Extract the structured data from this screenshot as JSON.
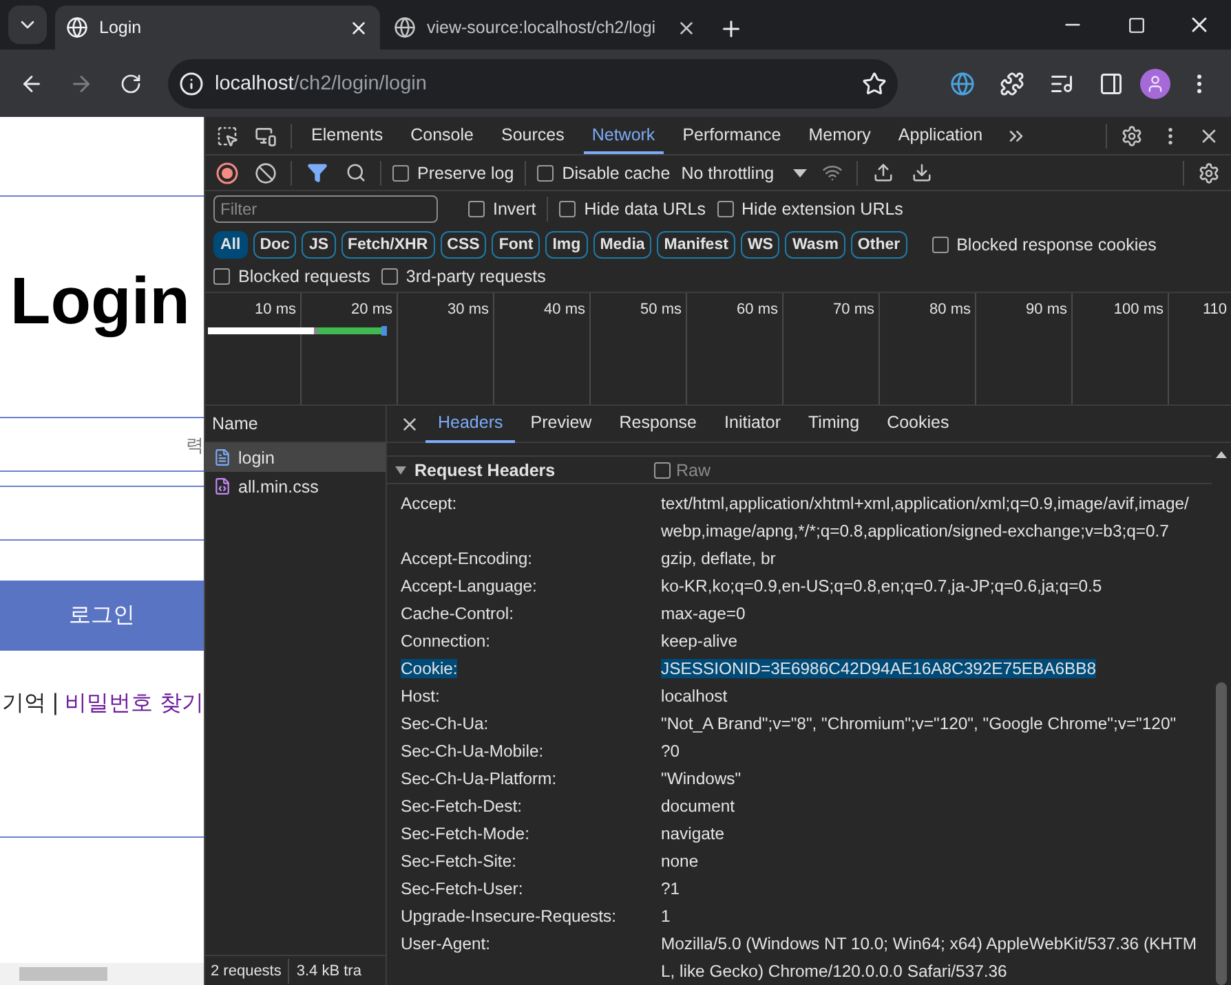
{
  "browser": {
    "tabs": [
      {
        "title": "Login",
        "selected": true
      },
      {
        "title": "view-source:localhost/ch2/logi",
        "selected": false
      }
    ],
    "address": {
      "host": "localhost",
      "path": "/ch2/login/login"
    }
  },
  "page": {
    "heading": "Login",
    "input_placeholder": "력",
    "button": "로그인",
    "remember": "기억",
    "separator": "|",
    "find_password": "비밀번호 찾기"
  },
  "devtools": {
    "panels": [
      {
        "label": "Elements",
        "selected": false
      },
      {
        "label": "Console",
        "selected": false
      },
      {
        "label": "Sources",
        "selected": false
      },
      {
        "label": "Network",
        "selected": true
      },
      {
        "label": "Performance",
        "selected": false
      },
      {
        "label": "Memory",
        "selected": false
      },
      {
        "label": "Application",
        "selected": false
      }
    ],
    "toolbar_options": [
      {
        "label": "Preserve log",
        "checked": false
      },
      {
        "label": "Disable cache",
        "checked": false
      }
    ],
    "throttling": "No throttling",
    "filter": {
      "placeholder": "Filter"
    },
    "filter_options": [
      {
        "label": "Invert",
        "checked": false
      },
      {
        "label": "Hide data URLs",
        "checked": false
      },
      {
        "label": "Hide extension URLs",
        "checked": false
      }
    ],
    "types": [
      {
        "label": "All",
        "selected": true
      },
      {
        "label": "Doc",
        "selected": false
      },
      {
        "label": "JS",
        "selected": false
      },
      {
        "label": "Fetch/XHR",
        "selected": false
      },
      {
        "label": "CSS",
        "selected": false
      },
      {
        "label": "Font",
        "selected": false
      },
      {
        "label": "Img",
        "selected": false
      },
      {
        "label": "Media",
        "selected": false
      },
      {
        "label": "Manifest",
        "selected": false
      },
      {
        "label": "WS",
        "selected": false
      },
      {
        "label": "Wasm",
        "selected": false
      },
      {
        "label": "Other",
        "selected": false
      }
    ],
    "blocked_response_cookies": {
      "label": "Blocked response cookies",
      "checked": false
    },
    "request_options": [
      {
        "label": "Blocked requests",
        "checked": false
      },
      {
        "label": "3rd-party requests",
        "checked": false
      }
    ],
    "timeline_ticks": [
      "10 ms",
      "20 ms",
      "30 ms",
      "40 ms",
      "50 ms",
      "60 ms",
      "70 ms",
      "80 ms",
      "90 ms",
      "100 ms",
      "110"
    ],
    "name_header": "Name",
    "requests": [
      {
        "name": "login",
        "kind": "document",
        "selected": true
      },
      {
        "name": "all.min.css",
        "kind": "stylesheet",
        "selected": false
      }
    ],
    "status": [
      "2 requests",
      "3.4 kB tra"
    ],
    "detail_tabs": [
      {
        "label": "Headers",
        "selected": true
      },
      {
        "label": "Preview",
        "selected": false
      },
      {
        "label": "Response",
        "selected": false
      },
      {
        "label": "Initiator",
        "selected": false
      },
      {
        "label": "Timing",
        "selected": false
      },
      {
        "label": "Cookies",
        "selected": false
      }
    ],
    "section": {
      "title": "Request Headers",
      "expanded": true,
      "raw": {
        "label": "Raw",
        "checked": false
      }
    },
    "headers": [
      {
        "name": "Accept:",
        "value": "text/html,application/xhtml+xml,application/xml;q=0.9,image/avif,image/webp,image/apng,*/*;q=0.8,application/signed-exchange;v=b3;q=0.7",
        "selected": false
      },
      {
        "name": "Accept-Encoding:",
        "value": "gzip, deflate, br",
        "selected": false
      },
      {
        "name": "Accept-Language:",
        "value": "ko-KR,ko;q=0.9,en-US;q=0.8,en;q=0.7,ja-JP;q=0.6,ja;q=0.5",
        "selected": false
      },
      {
        "name": "Cache-Control:",
        "value": "max-age=0",
        "selected": false
      },
      {
        "name": "Connection:",
        "value": "keep-alive",
        "selected": false
      },
      {
        "name": "Cookie:",
        "value": "JSESSIONID=3E6986C42D94AE16A8C392E75EBA6BB8",
        "selected": true
      },
      {
        "name": "Host:",
        "value": "localhost",
        "selected": false
      },
      {
        "name": "Sec-Ch-Ua:",
        "value": "\"Not_A Brand\";v=\"8\", \"Chromium\";v=\"120\", \"Google Chrome\";v=\"120\"",
        "selected": false
      },
      {
        "name": "Sec-Ch-Ua-Mobile:",
        "value": "?0",
        "selected": false
      },
      {
        "name": "Sec-Ch-Ua-Platform:",
        "value": "\"Windows\"",
        "selected": false
      },
      {
        "name": "Sec-Fetch-Dest:",
        "value": "document",
        "selected": false
      },
      {
        "name": "Sec-Fetch-Mode:",
        "value": "navigate",
        "selected": false
      },
      {
        "name": "Sec-Fetch-Site:",
        "value": "none",
        "selected": false
      },
      {
        "name": "Sec-Fetch-User:",
        "value": "?1",
        "selected": false
      },
      {
        "name": "Upgrade-Insecure-Requests:",
        "value": "1",
        "selected": false
      },
      {
        "name": "User-Agent:",
        "value": "Mozilla/5.0 (Windows NT 10.0; Win64; x64) AppleWebKit/537.36 (KHTML, like Gecko) Chrome/120.0.0.0 Safari/537.36",
        "selected": false
      }
    ]
  }
}
